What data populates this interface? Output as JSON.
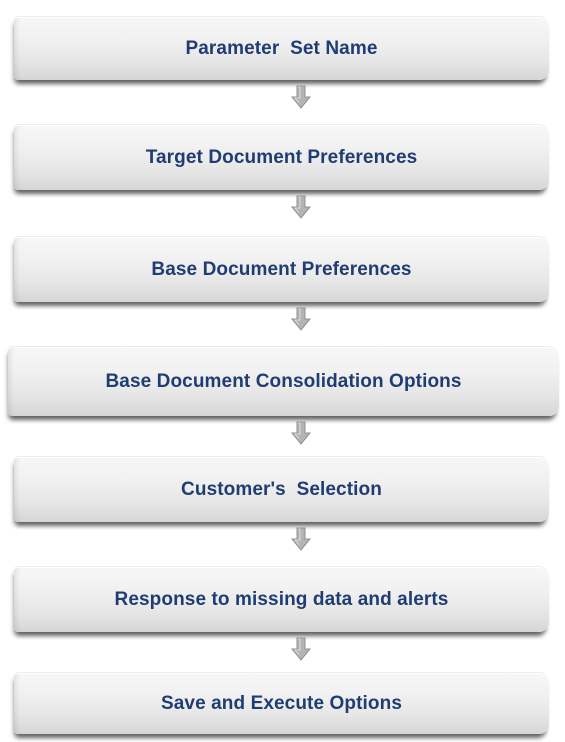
{
  "flowchart": {
    "steps": [
      {
        "label": "Parameter  Set Name"
      },
      {
        "label": "Target Document Preferences"
      },
      {
        "label": "Base Document Preferences"
      },
      {
        "label": "Base Document Consolidation Options"
      },
      {
        "label": "Customer's  Selection"
      },
      {
        "label": "Response to missing data and alerts"
      },
      {
        "label": "Save and Execute Options"
      }
    ]
  },
  "colors": {
    "label_text": "#1f3d73",
    "arrow_fill": "#b4b4b4",
    "box_light": "#f7f7f7",
    "box_dark": "#d6d6d6"
  }
}
